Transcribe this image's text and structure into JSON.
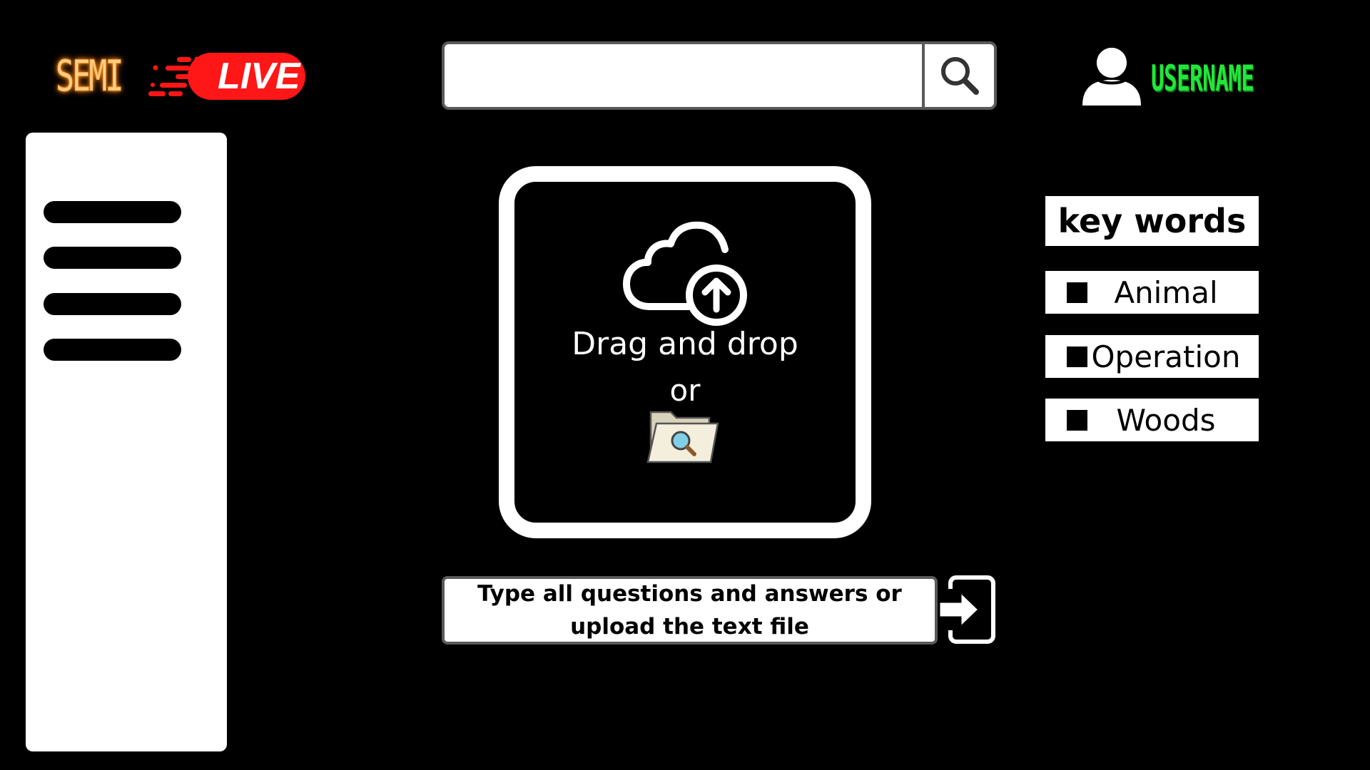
{
  "logo": {
    "text_part": "SEMI",
    "live_badge": "LIVE",
    "colors": {
      "semi": "#ffcf8a",
      "live_bg": "#ff1616"
    }
  },
  "search": {
    "value": "",
    "placeholder": "",
    "icon": "search-icon"
  },
  "user": {
    "icon": "user-icon",
    "name": "USERNAME",
    "color": "#23e63a"
  },
  "sidebar": {
    "items": [
      {
        "icon": "menu-line"
      },
      {
        "icon": "menu-line"
      },
      {
        "icon": "menu-line"
      },
      {
        "icon": "menu-line"
      }
    ]
  },
  "upload": {
    "icon": "cloud-upload-icon",
    "drag_text": "Drag and drop",
    "or_text": "or",
    "browse_icon": "folder-search-icon"
  },
  "entry": {
    "text": "Type all questions and answers or upload the text file",
    "submit_icon": "enter-arrow-icon"
  },
  "keywords": {
    "title": "key words",
    "items": [
      {
        "label": "Animal"
      },
      {
        "label": "Operation"
      },
      {
        "label": "Woods"
      }
    ]
  }
}
